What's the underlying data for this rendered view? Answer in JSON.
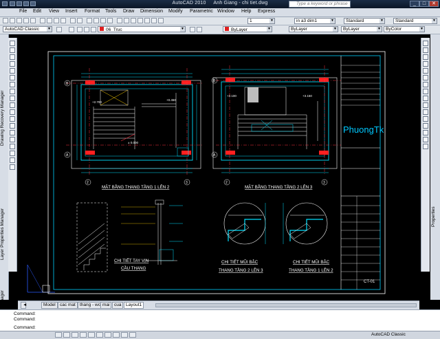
{
  "window": {
    "app_title": "AutoCAD 2010",
    "doc_title": "Anh Giang - chi tiet.dwg",
    "search_placeholder": "Type a keyword or phrase"
  },
  "menu": [
    "File",
    "Edit",
    "View",
    "Insert",
    "Format",
    "Tools",
    "Draw",
    "Dimension",
    "Modify",
    "Parametric",
    "Window",
    "Help",
    "Express"
  ],
  "toolbar1": {
    "scale_value": "1",
    "dimstyle_value": "in a3 dim1",
    "textstyle_value": "Standard",
    "tablestyle_value": "Standard"
  },
  "toolbar2": {
    "workspace": "AutoCAD Classic",
    "layer": "06_Truc",
    "color": "ByLayer",
    "linetype": "ByLayer",
    "lineweight": "ByLayer",
    "plotstyle": "ByColor"
  },
  "palettes": {
    "left_top": "Drawing Recovery Manager",
    "left_mid": "Layer Properties Manager",
    "left_bottom": "Sheet Set Manager",
    "right": "Properties"
  },
  "drawing": {
    "plan1_title": "MẶT BẰNG THANG TẦNG 1 LÊN 2",
    "plan2_title": "MẶT BẰNG THANG TẦNG 2 LÊN 3",
    "detail1_title_1": "CHI TIẾT TAY VỊN",
    "detail1_title_2": "CẦU THANG",
    "detail2_title_1": "CHI TIẾT MŨI BẬC",
    "detail2_title_2": "THANG TẦNG 2 LÊN 3",
    "detail3_title_1": "CHI TIẾT MŨI BẬC",
    "detail3_title_2": "THANG TẦNG 1 LÊN 2",
    "lvl_p1_left": "+2.700",
    "lvl_p1_right": "+0.450",
    "lvl_p1_bottom": "± 0.000",
    "lvl_p2_left": "+2.100",
    "lvl_p2_right": "+3.150",
    "grid_A": "A",
    "grid_B": "B",
    "grid_2": "2",
    "grid_3": "3",
    "logo": "PhuongTk",
    "sheet_no": "CT-01"
  },
  "tabs": [
    "Model",
    "cac mat",
    "thang - wc",
    "mai",
    "cua",
    "Layout1"
  ],
  "command": {
    "line1": "Command:",
    "line2": "Command:",
    "line3": "Command:"
  },
  "status": {
    "workspace": "AutoCAD Classic"
  }
}
